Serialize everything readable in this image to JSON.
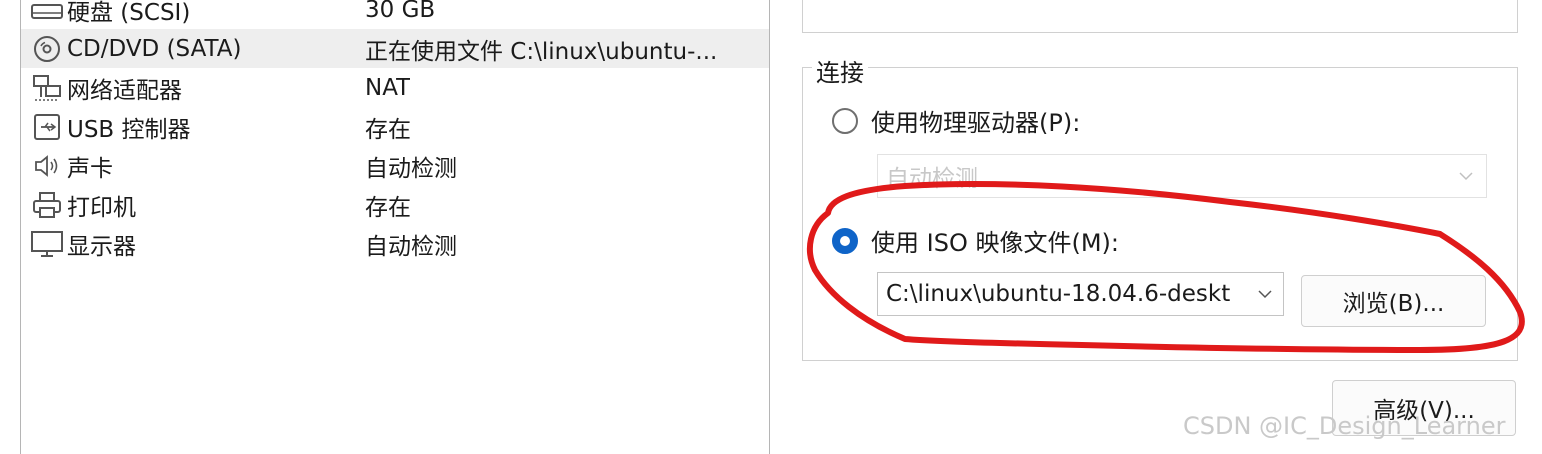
{
  "devices": [
    {
      "icon": "hard-disk-icon",
      "name": "硬盘 (SCSI)",
      "summary": "30 GB"
    },
    {
      "icon": "cd-dvd-icon",
      "name": "CD/DVD (SATA)",
      "summary": "正在使用文件 C:\\linux\\ubuntu-..."
    },
    {
      "icon": "network-adapter-icon",
      "name": "网络适配器",
      "summary": "NAT"
    },
    {
      "icon": "usb-controller-icon",
      "name": "USB 控制器",
      "summary": "存在"
    },
    {
      "icon": "sound-card-icon",
      "name": "声卡",
      "summary": "自动检测"
    },
    {
      "icon": "printer-icon",
      "name": "打印机",
      "summary": "存在"
    },
    {
      "icon": "display-icon",
      "name": "显示器",
      "summary": "自动检测"
    }
  ],
  "selected_device_index": 1,
  "connection": {
    "title": "连接",
    "physical_drive": {
      "label": "使用物理驱动器(P):",
      "checked": false,
      "select_value": "自动检测"
    },
    "iso_image": {
      "label": "使用 ISO 映像文件(M):",
      "checked": true,
      "path_value": "C:\\linux\\ubuntu-18.04.6-deskt",
      "browse_label": "浏览(B)..."
    }
  },
  "advanced_label": "高级(V)...",
  "watermark": "CSDN @IC_Design_Learner",
  "colors": {
    "radio_checked": "#0f64c8",
    "annotation_stroke": "#e01a1a",
    "selected_row": "#eeeeee"
  }
}
